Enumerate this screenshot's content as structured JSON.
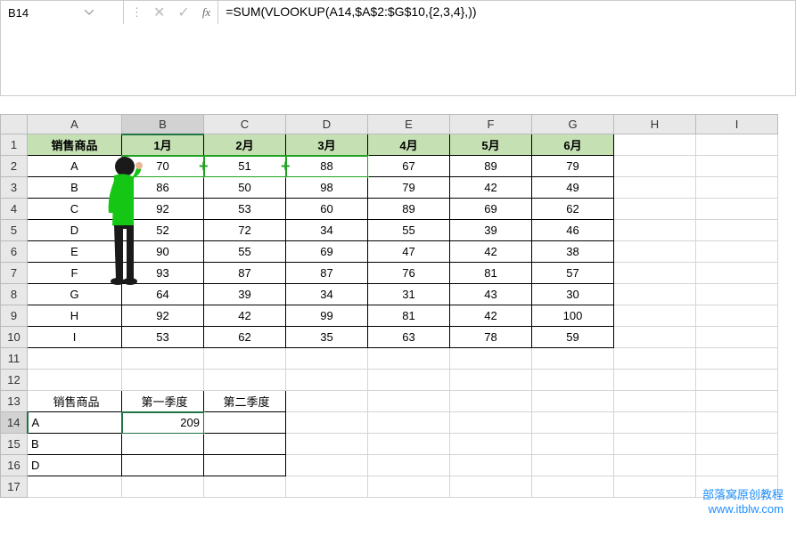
{
  "name_box": "B14",
  "formula": "=SUM(VLOOKUP(A14,$A$2:$G$10,{2,3,4},))",
  "columns": [
    "A",
    "B",
    "C",
    "D",
    "E",
    "F",
    "G",
    "H",
    "I"
  ],
  "rows": [
    "1",
    "2",
    "3",
    "4",
    "5",
    "6",
    "7",
    "8",
    "9",
    "10",
    "11",
    "12",
    "13",
    "14",
    "15",
    "16",
    "17"
  ],
  "table1": {
    "headers": [
      "销售商品",
      "1月",
      "2月",
      "3月",
      "4月",
      "5月",
      "6月"
    ],
    "rows": [
      [
        "A",
        70,
        51,
        88,
        67,
        89,
        79
      ],
      [
        "B",
        86,
        50,
        98,
        79,
        42,
        49
      ],
      [
        "C",
        92,
        53,
        60,
        89,
        69,
        62
      ],
      [
        "D",
        52,
        72,
        34,
        55,
        39,
        46
      ],
      [
        "E",
        90,
        55,
        69,
        47,
        42,
        38
      ],
      [
        "F",
        93,
        87,
        87,
        76,
        81,
        57
      ],
      [
        "G",
        64,
        39,
        34,
        31,
        43,
        30
      ],
      [
        "H",
        92,
        42,
        99,
        81,
        42,
        100
      ],
      [
        "I",
        53,
        62,
        35,
        63,
        78,
        59
      ]
    ]
  },
  "table2": {
    "headers": [
      "销售商品",
      "第一季度",
      "第二季度"
    ],
    "rows": [
      [
        "A",
        "209",
        ""
      ],
      [
        "B",
        "",
        ""
      ],
      [
        "D",
        "",
        ""
      ]
    ]
  },
  "watermark": {
    "l1": "部落窝原创教程",
    "l2": "www.itblw.com"
  },
  "chart_data": {
    "type": "table",
    "title": "销售商品 月度数据",
    "categories": [
      "1月",
      "2月",
      "3月",
      "4月",
      "5月",
      "6月"
    ],
    "series": [
      {
        "name": "A",
        "values": [
          70,
          51,
          88,
          67,
          89,
          79
        ]
      },
      {
        "name": "B",
        "values": [
          86,
          50,
          98,
          79,
          42,
          49
        ]
      },
      {
        "name": "C",
        "values": [
          92,
          53,
          60,
          89,
          69,
          62
        ]
      },
      {
        "name": "D",
        "values": [
          52,
          72,
          34,
          55,
          39,
          46
        ]
      },
      {
        "name": "E",
        "values": [
          90,
          55,
          69,
          47,
          42,
          38
        ]
      },
      {
        "name": "F",
        "values": [
          93,
          87,
          87,
          76,
          81,
          57
        ]
      },
      {
        "name": "G",
        "values": [
          64,
          39,
          34,
          31,
          43,
          30
        ]
      },
      {
        "name": "H",
        "values": [
          92,
          42,
          99,
          81,
          42,
          100
        ]
      },
      {
        "name": "I",
        "values": [
          53,
          62,
          35,
          63,
          78,
          59
        ]
      }
    ]
  }
}
